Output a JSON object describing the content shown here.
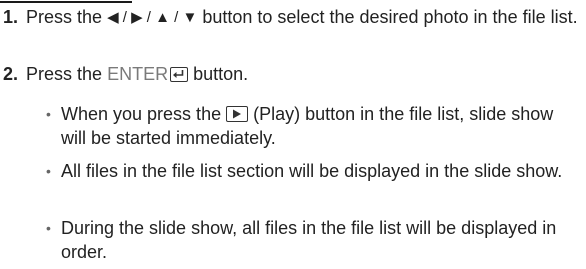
{
  "steps": [
    {
      "number": "1.",
      "text_before": "Press the",
      "arrows": "◀ / ▶ / ▲ / ▼",
      "text_after": "button to select the desired photo in the file list."
    },
    {
      "number": "2.",
      "text_before": "Press the",
      "button_name": "ENTER",
      "text_after": "button."
    }
  ],
  "bullets": [
    {
      "text_before": "When you press the",
      "text_after": "(Play) button in the file list, slide show will be started immediately."
    },
    {
      "text": "All files in the file list section will be displayed in the slide show."
    },
    {
      "text": "During the slide show, all files in the file list will be displayed in order."
    }
  ],
  "icons": {
    "enter": "enter-key-icon",
    "play": "play-button-icon"
  },
  "colors": {
    "text": "#222222",
    "highlight": "#7a7a7a",
    "bullet": "#666666"
  }
}
